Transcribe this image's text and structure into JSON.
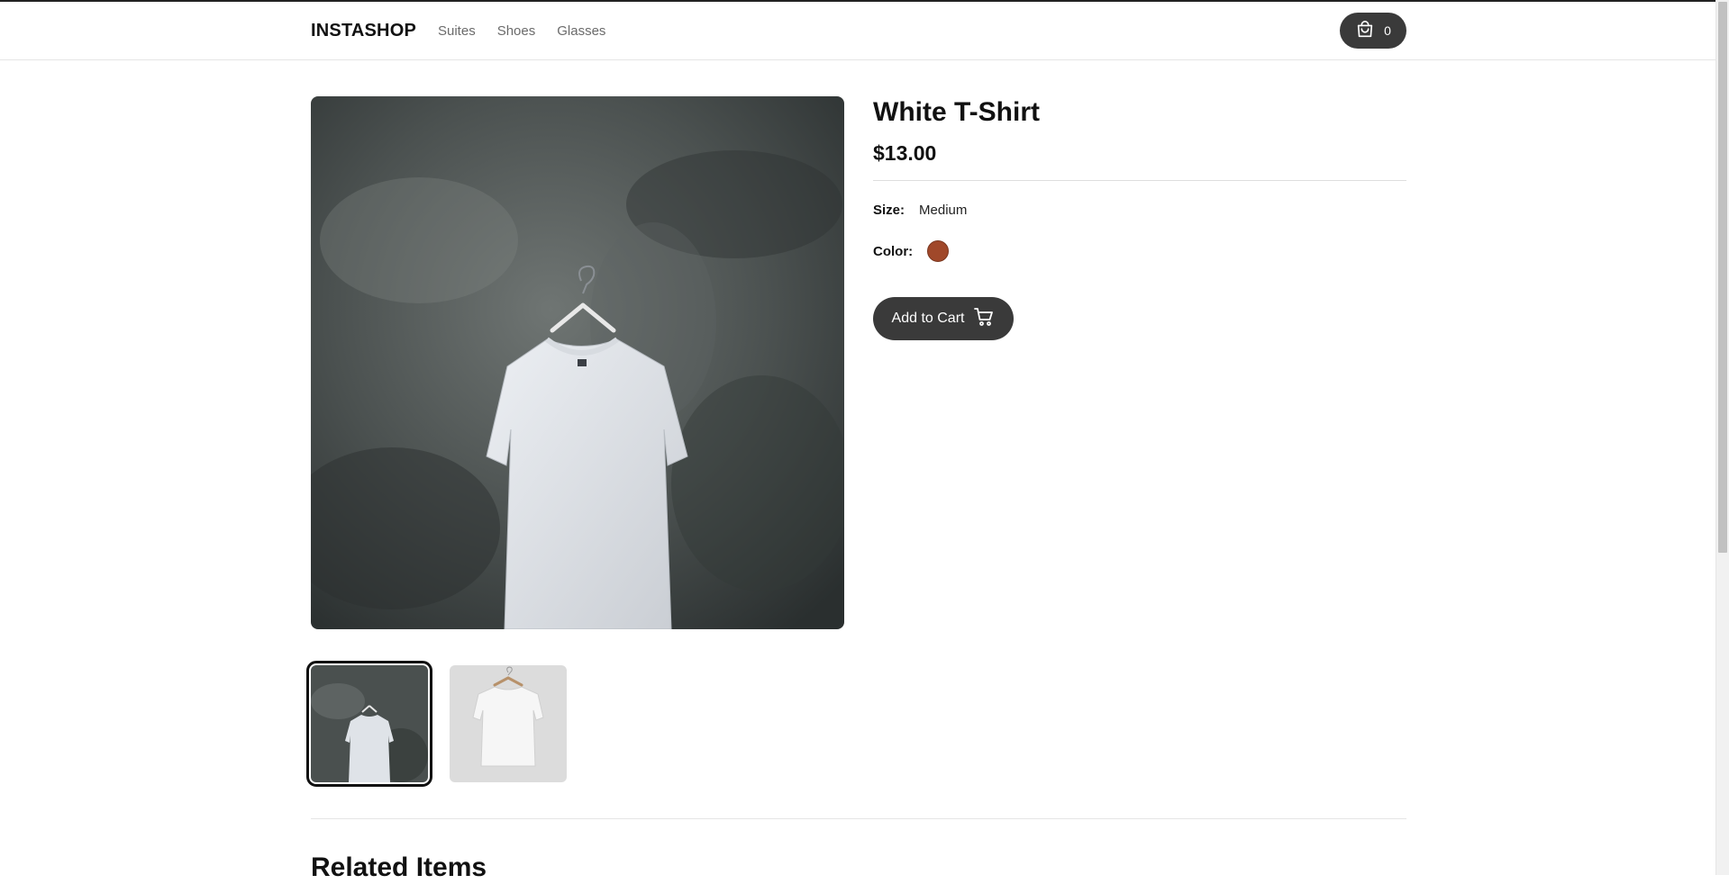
{
  "brand": "INSTASHOP",
  "nav": {
    "links": [
      "Suites",
      "Shoes",
      "Glasses"
    ]
  },
  "cart": {
    "count": "0",
    "icon": "shopping-bag-icon"
  },
  "product": {
    "title": "White T-Shirt",
    "price": "$13.00",
    "size_label": "Size:",
    "size_value": "Medium",
    "color_label": "Color:",
    "color_swatch": "#a0482a",
    "add_to_cart_label": "Add to Cart",
    "add_to_cart_icon": "cart-icon"
  },
  "gallery": {
    "thumbnails": [
      "white t-shirt on hanger against dark concrete wall",
      "white t-shirt on hanger against light wall"
    ],
    "active_index": 0
  },
  "related": {
    "title": "Related Items"
  },
  "colors": {
    "button_bg": "#3a3a3a",
    "text": "#111111",
    "nav_link": "#6b6b6b"
  }
}
